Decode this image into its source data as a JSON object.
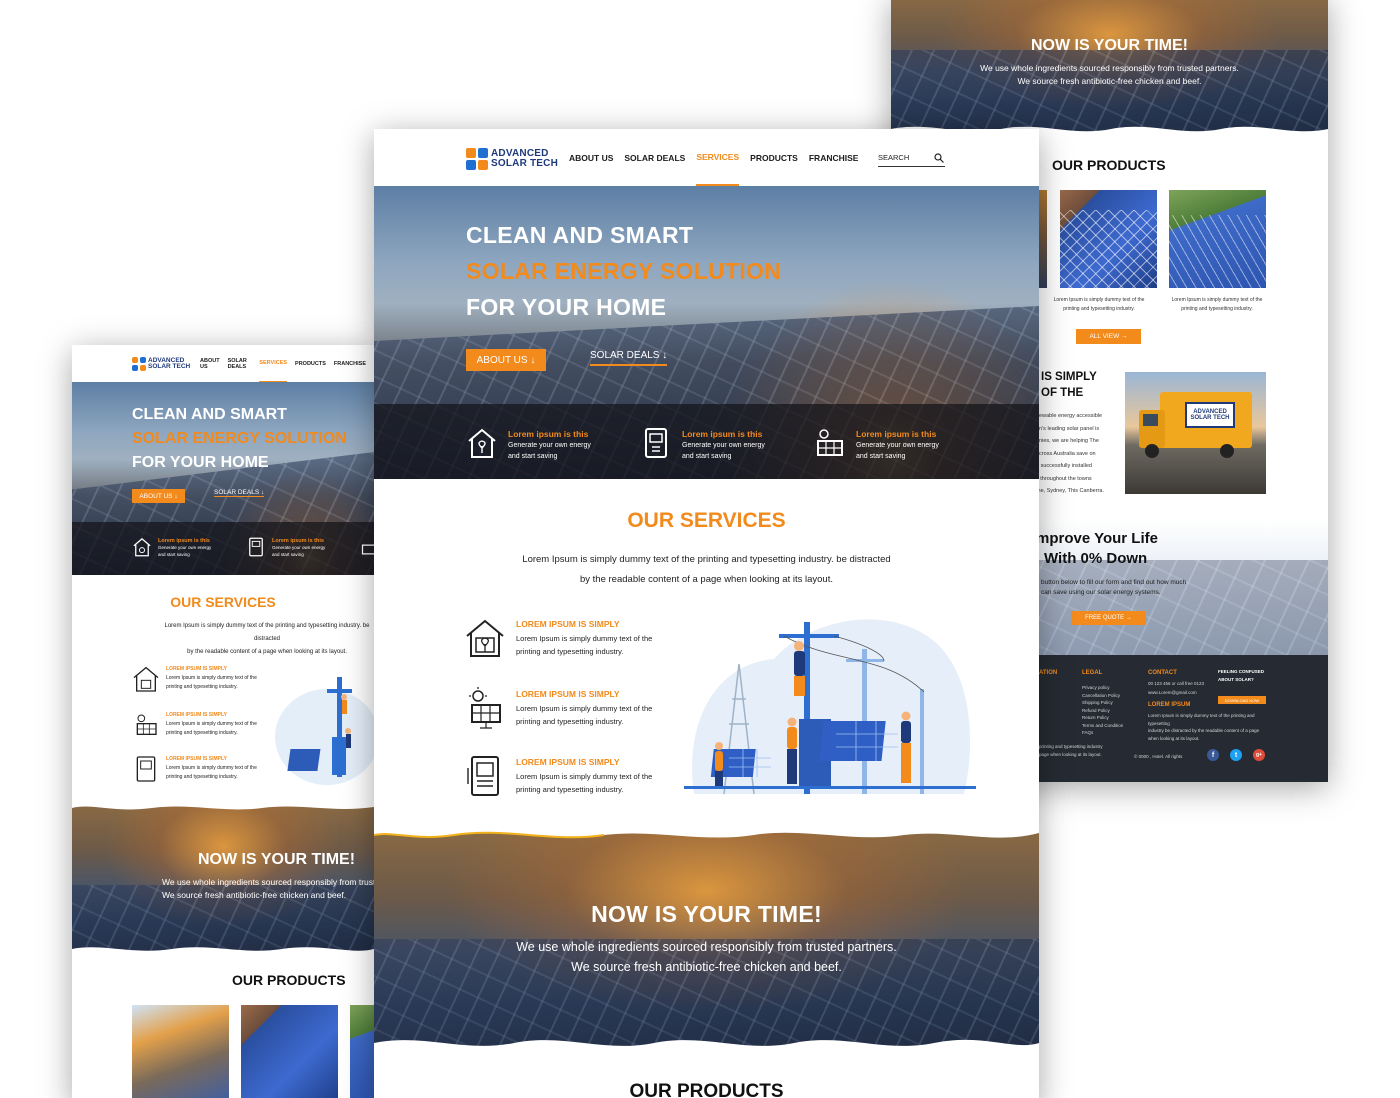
{
  "brand": {
    "line1": "ADVANCED",
    "line2": "SOLAR TECH"
  },
  "nav": {
    "items": [
      "ABOUT US",
      "SOLAR DEALS",
      "SERVICES",
      "PRODUCTS",
      "FRANCHISE"
    ],
    "active": "SERVICES",
    "search_placeholder": "SEARCH"
  },
  "hero": {
    "line1": "CLEAN AND SMART",
    "line2": "SOLAR ENERGY SOLUTION",
    "line3": "FOR YOUR HOME",
    "about_button": "ABOUT US ↓",
    "deals_button": "SOLAR DEALS ↓",
    "features": [
      {
        "title": "Lorem ipsum is this",
        "text1": "Generate your own energy",
        "text2": "and start saving"
      },
      {
        "title": "Lorem ipsum is this",
        "text1": "Generate your own energy",
        "text2": "and start saving"
      },
      {
        "title": "Lorem ipsum is this",
        "text1": "Generate your own energy",
        "text2": "and start saving"
      }
    ]
  },
  "services": {
    "title": "OUR SERVICES",
    "desc1": "Lorem Ipsum is simply dummy text of the printing and typesetting industry. be distracted",
    "desc2": "by the readable content of a page when looking at its layout.",
    "items": [
      {
        "title": "LOREM IPSUM IS SIMPLY",
        "text1": "Lorem Ipsum is simply dummy text of the",
        "text2": "printing and typesetting industry."
      },
      {
        "title": "LOREM IPSUM IS SIMPLY",
        "text1": "Lorem Ipsum is simply dummy text of the",
        "text2": "printing and typesetting industry."
      },
      {
        "title": "LOREM IPSUM IS SIMPLY",
        "text1": "Lorem Ipsum is simply dummy text of the",
        "text2": "printing and typesetting industry."
      }
    ]
  },
  "cta": {
    "title": "NOW IS YOUR TIME!",
    "line1": "We use whole ingredients sourced responsibly from trusted partners.",
    "line2": "We source fresh antibiotic-free chicken and beef."
  },
  "products": {
    "title": "OUR PRODUCTS",
    "caption1": "Lorem Ipsum is simply dummy text of the",
    "caption2": "printing and typesetting industry.",
    "all_view": "ALL VIEW →"
  },
  "about_right": {
    "title1": "IS SIMPLY",
    "title2": "OF THE",
    "lines": [
      "newable energy accessible",
      "on's leading solar panel is",
      "anies, we are helping The",
      "across Australia save on",
      "e successfully installed",
      "s throughout the towns",
      "me, Sydney, This Canberra."
    ],
    "truck_label": "ADVANCED SOLAR TECH"
  },
  "quote": {
    "line1": "mprove Your Life",
    "line2": "With 0% Down",
    "p1": "button below to fill our form and find out how much",
    "p2": "can save using our solar energy systems.",
    "button": "FREE QUOTE →"
  },
  "footer": {
    "col0_title": "ATION",
    "legal_title": "LEGAL",
    "legal_items": [
      "Privacy policy",
      "Cancellation Policy",
      "Shipping Policy",
      "Refund Policy",
      "Return Policy",
      "Terms and Condition",
      "FAQs"
    ],
    "contact_title": "CONTACT",
    "contact_phone": "00 123 456 or call free 0123",
    "contact_email": "www.Lorem@gmail.com",
    "lorem_title": "LOREM IPSUM",
    "lorem_text1": "Lorem Ipsum is simply dummy text of the printing and typesetting",
    "lorem_text2": "industry be distracted by the readable content of a page",
    "lorem_text3": "when looking at its layout.",
    "confused1": "FEELING CONFUSED",
    "confused2": "ABOUT SOLAR?",
    "download": "DOWNLOAD NOW",
    "left_text1": "printing and typesetting industry",
    "left_text2": "page when looking at its layout.",
    "copyright": "© 0000 , Hotel. All rights",
    "social": [
      "f",
      "t",
      "g+"
    ]
  },
  "colors": {
    "accent": "#f28a1c",
    "brand_blue": "#1f3a7a",
    "footer": "#262b33"
  }
}
